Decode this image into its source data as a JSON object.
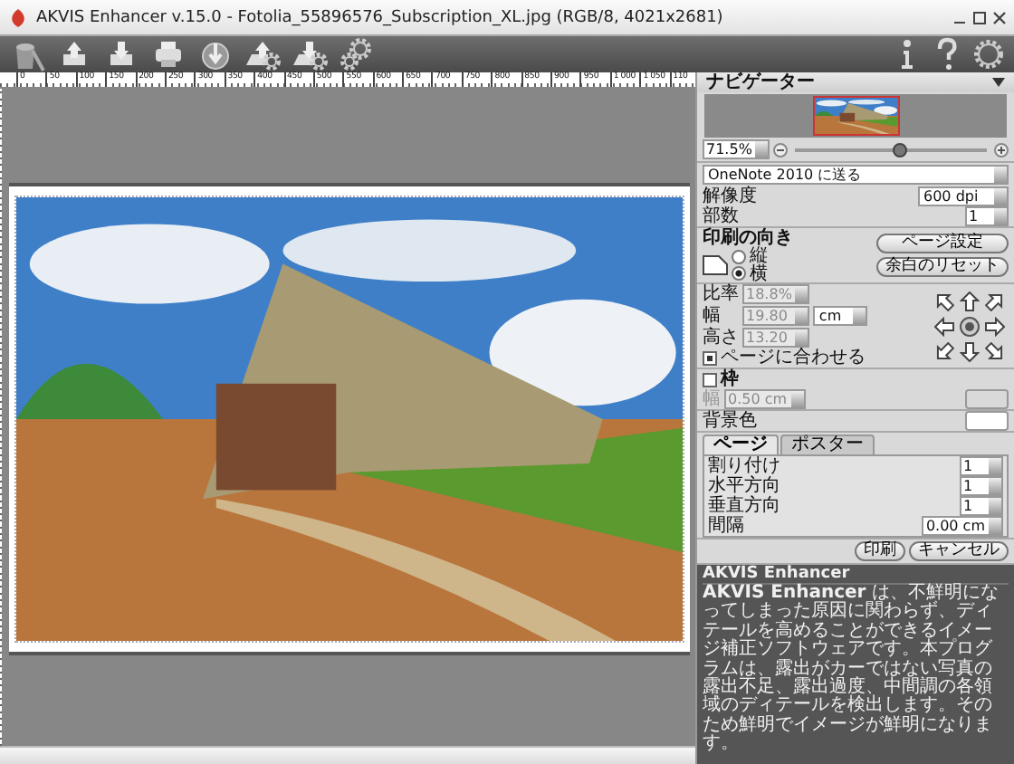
{
  "window": {
    "title": "AKVIS Enhancer v.15.0 - Fotolia_55896576_Subscription_XL.jpg (RGB/8, 4021x2681)"
  },
  "ruler": {
    "labels": [
      "0",
      "50",
      "100",
      "150",
      "200",
      "250",
      "300",
      "350",
      "400",
      "450",
      "500",
      "550",
      "600",
      "650",
      "700",
      "750",
      "800",
      "850",
      "900",
      "950",
      "1 000",
      "1 050",
      "110"
    ]
  },
  "navigator": {
    "title": "ナビゲーター",
    "zoom": "71.5%",
    "level": 0.55
  },
  "print": {
    "printer": "OneNote 2010 に送る",
    "resolution_label": "解像度",
    "resolution": "600 dpi",
    "copies_label": "部数",
    "copies": "1"
  },
  "orientation": {
    "title": "印刷の向き",
    "options": [
      {
        "label": "縦",
        "selected": false
      },
      {
        "label": "横",
        "selected": true
      }
    ]
  },
  "page_buttons": [
    "ページ設定",
    "余白のリセット"
  ],
  "size": {
    "fields": [
      {
        "label": "比率",
        "value": "18.8%",
        "disabled": true
      },
      {
        "label": "幅",
        "value": "19.80",
        "disabled": true
      },
      {
        "label": "高さ",
        "value": "13.20",
        "disabled": true
      }
    ],
    "unit": "cm",
    "fit": {
      "label": "ページに合わせる",
      "checked": true
    }
  },
  "frame": {
    "label": "枠",
    "checked": false,
    "width_label": "幅",
    "width": "0.50 cm",
    "disabled": true
  },
  "background": {
    "label": "背景色"
  },
  "tabs": [
    {
      "label": "ページ",
      "selected": true
    },
    {
      "label": "ポスター",
      "selected": false
    }
  ],
  "layout_rows": [
    {
      "label": "割り付け",
      "value": "1"
    },
    {
      "label": "水平方向",
      "value": "1"
    },
    {
      "label": "垂直方向",
      "value": "1"
    },
    {
      "label": "間隔",
      "value": "0.00 cm"
    }
  ],
  "actions": [
    "印刷",
    "キャンセル"
  ],
  "info": {
    "title": "AKVIS Enhancer",
    "text": "**AKVIS Enhancer** は、不鮮明になってしまった原因に関わらず、ディテールを高めることができるイメージ補正ソフトウェアです。本プログラムは、露出がカーではない写真の露出不足、露出過度、中間調の各領域のディテールを検出します。そのため鮮明でイメージが鮮明になります。"
  }
}
